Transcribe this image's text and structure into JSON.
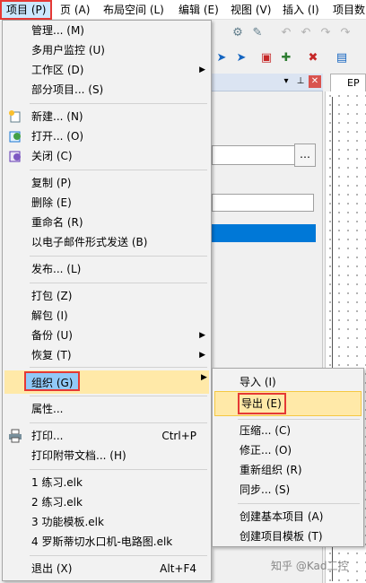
{
  "menubar": {
    "items": [
      {
        "label": "项目 (P)"
      },
      {
        "label": "页 (A)"
      },
      {
        "label": "布局空间 (L)"
      },
      {
        "label": "编辑 (E)"
      },
      {
        "label": "视图 (V)"
      },
      {
        "label": "插入 (I)"
      },
      {
        "label": "项目数"
      }
    ]
  },
  "background": {
    "canvas_tab": "EP"
  },
  "project_menu": {
    "manage": "管理... (M)",
    "multi_user": "多用户监控 (U)",
    "workspace": "工作区 (D)",
    "partial": "部分项目... (S)",
    "new": "新建... (N)",
    "open": "打开... (O)",
    "close": "关闭 (C)",
    "copy": "复制 (P)",
    "delete": "删除 (E)",
    "rename": "重命名 (R)",
    "email": "以电子邮件形式发送 (B)",
    "publish": "发布... (L)",
    "pack": "打包 (Z)",
    "unpack": "解包 (I)",
    "backup": "备份 (U)",
    "restore": "恢复 (T)",
    "organize": "组织 (G)",
    "properties": "属性...",
    "print": "打印...",
    "print_shortcut": "Ctrl+P",
    "print_attached": "打印附带文档... (H)",
    "recent_1": "1 练习.elk",
    "recent_2": "2 练习.elk",
    "recent_3": "3 功能模板.elk",
    "recent_4": "4 罗斯蒂切水口机-电路图.elk",
    "exit": "退出 (X)",
    "exit_shortcut": "Alt+F4"
  },
  "organize_submenu": {
    "import": "导入 (I)",
    "export": "导出 (E)",
    "compress": "压缩... (C)",
    "correct": "修正... (O)",
    "reorganize": "重新组织 (R)",
    "sync": "同步... (S)",
    "create_basic": "创建基本项目 (A)",
    "create_template": "创建项目模板 (T)"
  },
  "watermark": "知乎 @Kad工控"
}
